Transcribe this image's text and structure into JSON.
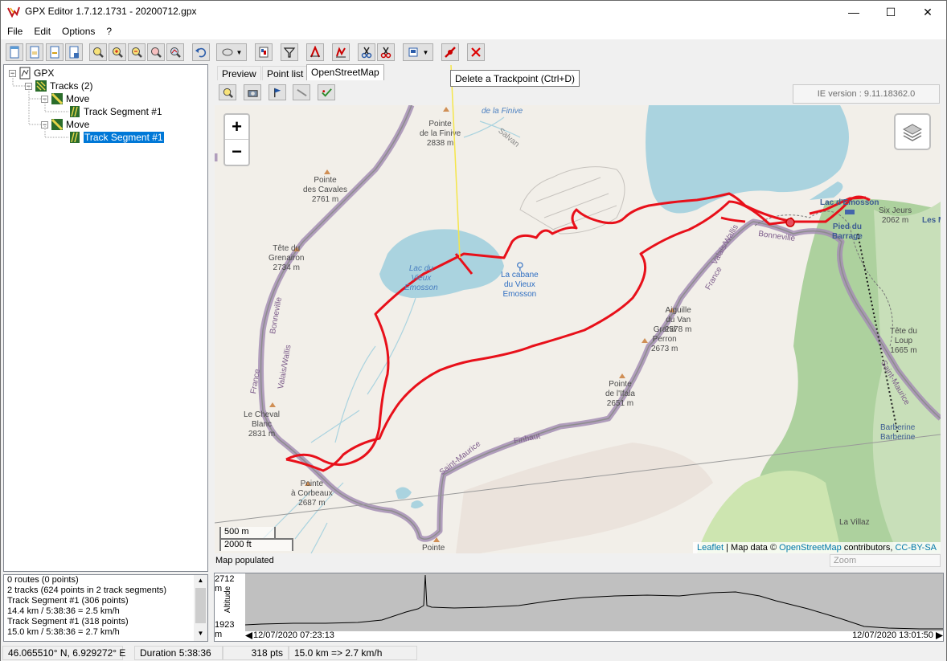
{
  "window": {
    "title": "GPX Editor 1.7.12.1731 - 20200712.gpx",
    "minimize": "—",
    "maximize": "☐",
    "close": "✕"
  },
  "menu": [
    "File",
    "Edit",
    "Options",
    "?"
  ],
  "tooltip": "Delete a Trackpoint (Ctrl+D)",
  "tree": {
    "root": "GPX",
    "tracks": "Tracks (2)",
    "track1": "Move",
    "seg1": "Track Segment #1",
    "track2": "Move",
    "seg2": "Track Segment #1"
  },
  "info": [
    "0 routes (0 points)",
    "2 tracks (624 points in 2 track segments)",
    "Track Segment #1 (306 points)",
    " 14.4 km / 5:38:36 = 2.5 km/h",
    "Track Segment #1 (318 points)",
    " 15.0 km / 5:38:36 = 2.7 km/h"
  ],
  "tabs": [
    "Preview",
    "Point list",
    "OpenStreetMap"
  ],
  "ie_version": "IE version : 9.11.18362.0",
  "map": {
    "zoom_in": "+",
    "zoom_out": "−",
    "scale_metric": "500 m",
    "scale_imperial": "2000 ft",
    "attribution_leaflet": "Leaflet",
    "attribution_mid": " | Map data © ",
    "attribution_osm": "OpenStreetMap",
    "attribution_contrib": " contributors, ",
    "attribution_license": "CC-BY-SA",
    "labels": {
      "finive_lake": "de la Finive",
      "finive_peak": "Pointe\nde la Finive\n2838 m",
      "salvan": "Salvan",
      "cavales": "Pointe\ndes Cavales\n2761 m",
      "grenairon": "Tête du\nGrenairon\n2734 m",
      "vieux_emosson": "Lac du\nVieux\nEmosson",
      "cabane": "La cabane\ndu Vieux\nEmosson",
      "lac_emosson": "Lac d'Emosson",
      "six_jeurs": "Six Jeurs\n2062 m",
      "les_m": "Les M",
      "pied_barrage": "Pied du\nBarrage",
      "bonneville_right": "Bonneville",
      "aiguille": "Aiguille\ndu Van\n2578 m",
      "grand_perron": "Grand\nPerron\n2673 m",
      "ifala": "Pointe\nde l'Ifala\n2651 m",
      "tete_loup": "Tête du\nLoup\n1665 m",
      "cheval_blanc": "Le Cheval\nBlanc\n2831 m",
      "corbeaux": "Pointe\nà Corbeaux\n2687 m",
      "pointe_bottom": "Pointe",
      "barberine": "Barberine\nBarberine",
      "villaz": "La Villaz",
      "finhaut": "Finhaut",
      "saint_maurice": "Saint-Maurice",
      "bonneville_left": "Bonneville",
      "valais_left": "Valais/Wallis",
      "france_left": "France",
      "valais_right": "Valais/Wallis",
      "france_right": "France",
      "saint_maurice_right": "Saint-Maurice"
    }
  },
  "map_status": "Map populated",
  "zoom_box": "Zoom",
  "profile": {
    "y_max": "2712 m",
    "y_min": "1923 m",
    "axis": "Altitude",
    "start": "12/07/2020 07:23:13",
    "end": "12/07/2020 13:01:50"
  },
  "status": {
    "coords": "46.065510° N, 6.929272° E",
    "duration": "Duration 5:38:36",
    "points": "318 pts",
    "distance": "15.0 km => 2.7 km/h"
  },
  "colors": {
    "track": "#e8101a",
    "water": "#aad3df",
    "forest": "#add19e",
    "boundary": "#a58eb4",
    "selection": "#0078d7"
  }
}
